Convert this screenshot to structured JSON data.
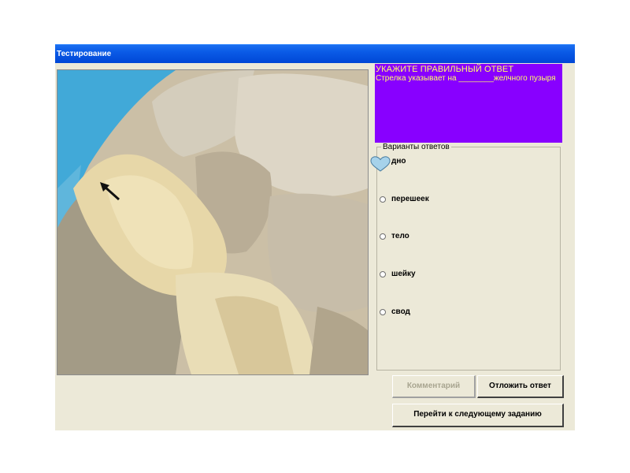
{
  "window": {
    "title": "Тестирование"
  },
  "question": {
    "heading": "УКАЖИТЕ ПРАВИЛЬНЫЙ ОТВЕТ",
    "text": "Стрелка указывает на ________желчного пузыря"
  },
  "options": {
    "legend": "Варианты ответов",
    "items": [
      {
        "label": "дно",
        "selected": true
      },
      {
        "label": "перешеек",
        "selected": false
      },
      {
        "label": "тело",
        "selected": false
      },
      {
        "label": "шейку",
        "selected": false
      },
      {
        "label": "свод",
        "selected": false
      }
    ]
  },
  "buttons": {
    "comment": "Комментарий",
    "postpone": "Отложить ответ",
    "next": "Перейти к следующему заданию"
  },
  "colors": {
    "title_bar": "#0a5ae6",
    "question_bg": "#8800ff",
    "question_text": "#ffff66",
    "window_bg": "#ece9d8"
  },
  "icons": {
    "selected_marker": "heart-icon",
    "pointer": "arrow-icon"
  }
}
